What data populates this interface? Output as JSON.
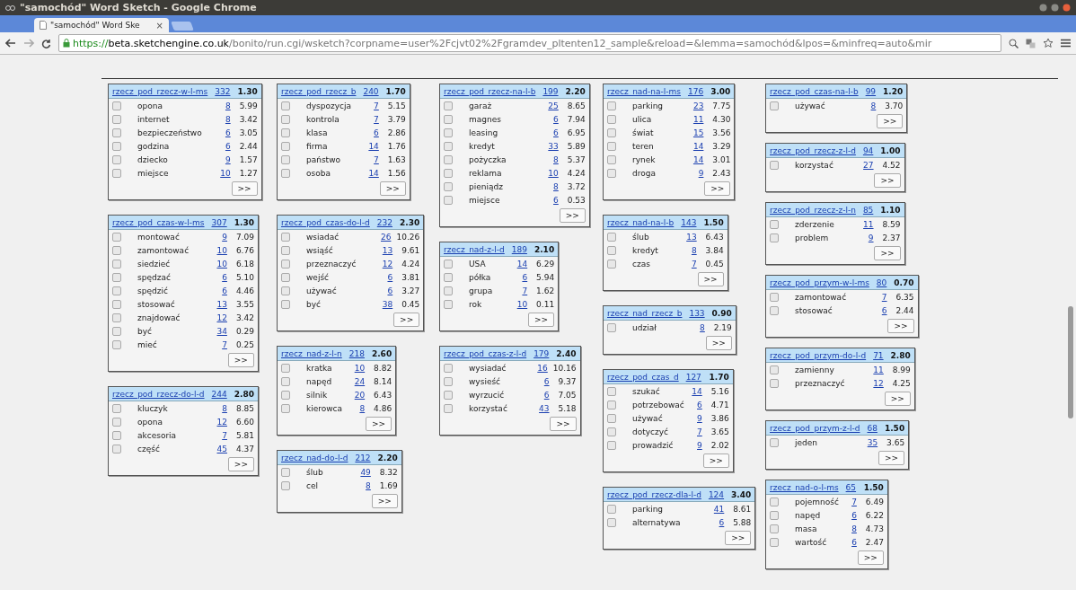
{
  "window": {
    "title": "\"samochód\" Word Sketch - Google Chrome"
  },
  "tab": {
    "label": "\"samochód\" Word Ske",
    "close": "×"
  },
  "address_bar": {
    "scheme": "https://",
    "host": "beta.sketchengine.co.uk",
    "path": "/bonito/run.cgi/wsketch?corpname=user%2Fcjvt02%2Fgramdev_pltenten12_sample&reload=&lemma=samochód&lpos=&minfreq=auto&mir"
  },
  "columns": [
    {
      "boxes": [
        {
          "relation": "rzecz_pod_rzecz-w-l-ms",
          "count": "332",
          "score": "1.30",
          "more": ">>",
          "rows": [
            {
              "word": "opona",
              "freq": "8",
              "score": "5.99",
              "checked": false
            },
            {
              "word": "internet",
              "freq": "8",
              "score": "3.42",
              "checked": false
            },
            {
              "word": "bezpieczeństwo",
              "freq": "6",
              "score": "3.05",
              "checked": false
            },
            {
              "word": "godzina",
              "freq": "6",
              "score": "2.44",
              "checked": false
            },
            {
              "word": "dziecko",
              "freq": "9",
              "score": "1.57",
              "checked": false
            },
            {
              "word": "miejsce",
              "freq": "10",
              "score": "1.27",
              "checked": false
            }
          ]
        },
        {
          "relation": "rzecz_pod_czas-w-l-ms",
          "count": "307",
          "score": "1.30",
          "more": ">>",
          "rows": [
            {
              "word": "montować",
              "freq": "9",
              "score": "7.09",
              "checked": false
            },
            {
              "word": "zamontować",
              "freq": "10",
              "score": "6.76",
              "checked": false
            },
            {
              "word": "siedzieć",
              "freq": "10",
              "score": "6.18",
              "checked": false
            },
            {
              "word": "spędzać",
              "freq": "6",
              "score": "5.10",
              "checked": false
            },
            {
              "word": "spędzić",
              "freq": "6",
              "score": "4.46",
              "checked": false
            },
            {
              "word": "stosować",
              "freq": "13",
              "score": "3.55",
              "checked": false
            },
            {
              "word": "znajdować",
              "freq": "12",
              "score": "3.42",
              "checked": false
            },
            {
              "word": "być",
              "freq": "34",
              "score": "0.29",
              "checked": false
            },
            {
              "word": "mieć",
              "freq": "7",
              "score": "0.25",
              "checked": false
            }
          ]
        },
        {
          "relation": "rzecz_pod_rzecz-do-l-d",
          "count": "244",
          "score": "2.80",
          "more": ">>",
          "rows": [
            {
              "word": "kluczyk",
              "freq": "8",
              "score": "8.85",
              "checked": false
            },
            {
              "word": "opona",
              "freq": "12",
              "score": "6.60",
              "checked": false
            },
            {
              "word": "akcesoria",
              "freq": "7",
              "score": "5.81",
              "checked": false
            },
            {
              "word": "część",
              "freq": "45",
              "score": "4.37",
              "checked": false
            }
          ]
        }
      ]
    },
    {
      "boxes": [
        {
          "relation": "rzecz_pod_rzecz_b",
          "count": "240",
          "score": "1.70",
          "more": ">>",
          "rows": [
            {
              "word": "dyspozycja",
              "freq": "7",
              "score": "5.15",
              "checked": false
            },
            {
              "word": "kontrola",
              "freq": "7",
              "score": "3.79",
              "checked": false
            },
            {
              "word": "klasa",
              "freq": "6",
              "score": "2.86",
              "checked": false
            },
            {
              "word": "firma",
              "freq": "14",
              "score": "1.76",
              "checked": false
            },
            {
              "word": "państwo",
              "freq": "7",
              "score": "1.63",
              "checked": false
            },
            {
              "word": "osoba",
              "freq": "14",
              "score": "1.56",
              "checked": false
            }
          ]
        },
        {
          "relation": "rzecz_pod_czas-do-l-d",
          "count": "232",
          "score": "2.30",
          "more": ">>",
          "rows": [
            {
              "word": "wsiadać",
              "freq": "26",
              "score": "10.26",
              "checked": false
            },
            {
              "word": "wsiąść",
              "freq": "13",
              "score": "9.61",
              "checked": false
            },
            {
              "word": "przeznaczyć",
              "freq": "12",
              "score": "4.24",
              "checked": false
            },
            {
              "word": "wejść",
              "freq": "6",
              "score": "3.81",
              "checked": false
            },
            {
              "word": "używać",
              "freq": "6",
              "score": "3.27",
              "checked": false
            },
            {
              "word": "być",
              "freq": "38",
              "score": "0.45",
              "checked": false
            }
          ]
        },
        {
          "relation": "rzecz_nad-z-l-n",
          "count": "218",
          "score": "2.60",
          "more": ">>",
          "rows": [
            {
              "word": "kratka",
              "freq": "10",
              "score": "8.82",
              "checked": false
            },
            {
              "word": "napęd",
              "freq": "24",
              "score": "8.14",
              "checked": false
            },
            {
              "word": "silnik",
              "freq": "20",
              "score": "6.43",
              "checked": false
            },
            {
              "word": "kierowca",
              "freq": "8",
              "score": "4.86",
              "checked": false
            }
          ]
        },
        {
          "relation": "rzecz_nad-do-l-d",
          "count": "212",
          "score": "2.20",
          "more": ">>",
          "rows": [
            {
              "word": "ślub",
              "freq": "49",
              "score": "8.32",
              "checked": false
            },
            {
              "word": "cel",
              "freq": "8",
              "score": "1.69",
              "checked": false
            }
          ]
        }
      ]
    },
    {
      "boxes": [
        {
          "relation": "rzecz_pod_rzecz-na-l-b",
          "count": "199",
          "score": "2.20",
          "more": ">>",
          "rows": [
            {
              "word": "garaż",
              "freq": "25",
              "score": "8.65",
              "checked": false
            },
            {
              "word": "magnes",
              "freq": "6",
              "score": "7.94",
              "checked": false
            },
            {
              "word": "leasing",
              "freq": "6",
              "score": "6.95",
              "checked": false
            },
            {
              "word": "kredyt",
              "freq": "33",
              "score": "5.89",
              "checked": false
            },
            {
              "word": "pożyczka",
              "freq": "8",
              "score": "5.37",
              "checked": false
            },
            {
              "word": "reklama",
              "freq": "10",
              "score": "4.24",
              "checked": false
            },
            {
              "word": "pieniądz",
              "freq": "8",
              "score": "3.72",
              "checked": false
            },
            {
              "word": "miejsce",
              "freq": "6",
              "score": "0.53",
              "checked": false
            }
          ]
        },
        {
          "relation": "rzecz_nad-z-l-d",
          "count": "189",
          "score": "2.10",
          "more": ">>",
          "rows": [
            {
              "word": "USA",
              "freq": "14",
              "score": "6.29",
              "checked": false
            },
            {
              "word": "półka",
              "freq": "6",
              "score": "5.94",
              "checked": false
            },
            {
              "word": "grupa",
              "freq": "7",
              "score": "1.62",
              "checked": false
            },
            {
              "word": "rok",
              "freq": "10",
              "score": "0.11",
              "checked": false
            }
          ]
        },
        {
          "relation": "rzecz_pod_czas-z-l-d",
          "count": "179",
          "score": "2.40",
          "more": ">>",
          "rows": [
            {
              "word": "wysiadać",
              "freq": "16",
              "score": "10.16",
              "checked": false
            },
            {
              "word": "wysieść",
              "freq": "6",
              "score": "9.37",
              "checked": false
            },
            {
              "word": "wyrzucić",
              "freq": "6",
              "score": "7.05",
              "checked": false
            },
            {
              "word": "korzystać",
              "freq": "43",
              "score": "5.18",
              "checked": false
            }
          ]
        }
      ]
    },
    {
      "boxes": [
        {
          "relation": "rzecz_nad-na-l-ms",
          "count": "176",
          "score": "3.00",
          "more": ">>",
          "rows": [
            {
              "word": "parking",
              "freq": "23",
              "score": "7.75",
              "checked": false
            },
            {
              "word": "ulica",
              "freq": "11",
              "score": "4.30",
              "checked": false
            },
            {
              "word": "świat",
              "freq": "15",
              "score": "3.56",
              "checked": false
            },
            {
              "word": "teren",
              "freq": "14",
              "score": "3.29",
              "checked": false
            },
            {
              "word": "rynek",
              "freq": "14",
              "score": "3.01",
              "checked": false
            },
            {
              "word": "droga",
              "freq": "9",
              "score": "2.43",
              "checked": false
            }
          ]
        },
        {
          "relation": "rzecz_nad-na-l-b",
          "count": "143",
          "score": "1.50",
          "more": ">>",
          "rows": [
            {
              "word": "ślub",
              "freq": "13",
              "score": "6.43",
              "checked": false
            },
            {
              "word": "kredyt",
              "freq": "8",
              "score": "3.84",
              "checked": false
            },
            {
              "word": "czas",
              "freq": "7",
              "score": "0.45",
              "checked": false
            }
          ]
        },
        {
          "relation": "rzecz_nad_rzecz_b",
          "count": "133",
          "score": "0.90",
          "more": ">>",
          "rows": [
            {
              "word": "udział",
              "freq": "8",
              "score": "2.19",
              "checked": false
            }
          ]
        },
        {
          "relation": "rzecz_pod_czas_d",
          "count": "127",
          "score": "1.70",
          "more": ">>",
          "rows": [
            {
              "word": "szukać",
              "freq": "14",
              "score": "5.16",
              "checked": false
            },
            {
              "word": "potrzebować",
              "freq": "6",
              "score": "4.71",
              "checked": false
            },
            {
              "word": "używać",
              "freq": "9",
              "score": "3.86",
              "checked": false
            },
            {
              "word": "dotyczyć",
              "freq": "7",
              "score": "3.65",
              "checked": false
            },
            {
              "word": "prowadzić",
              "freq": "9",
              "score": "2.02",
              "checked": false
            }
          ]
        },
        {
          "relation": "rzecz_pod_rzecz-dla-l-d",
          "count": "124",
          "score": "3.40",
          "more": ">>",
          "rows": [
            {
              "word": "parking",
              "freq": "41",
              "score": "8.61",
              "checked": false
            },
            {
              "word": "alternatywa",
              "freq": "6",
              "score": "5.88",
              "checked": false
            }
          ]
        }
      ]
    },
    {
      "boxes": [
        {
          "relation": "rzecz_pod_czas-na-l-b",
          "count": "99",
          "score": "1.20",
          "more": ">>",
          "rows": [
            {
              "word": "używać",
              "freq": "8",
              "score": "3.70",
              "checked": false
            }
          ]
        },
        {
          "relation": "rzecz_pod_rzecz-z-l-d",
          "count": "94",
          "score": "1.00",
          "more": ">>",
          "rows": [
            {
              "word": "korzystać",
              "freq": "27",
              "score": "4.52",
              "checked": false
            }
          ]
        },
        {
          "relation": "rzecz_pod_rzecz-z-l-n",
          "count": "85",
          "score": "1.10",
          "more": ">>",
          "rows": [
            {
              "word": "zderzenie",
              "freq": "11",
              "score": "8.59",
              "checked": false
            },
            {
              "word": "problem",
              "freq": "9",
              "score": "2.37",
              "checked": false
            }
          ]
        },
        {
          "relation": "rzecz_pod_przym-w-l-ms",
          "count": "80",
          "score": "0.70",
          "more": ">>",
          "rows": [
            {
              "word": "zamontować",
              "freq": "7",
              "score": "6.35",
              "checked": false
            },
            {
              "word": "stosować",
              "freq": "6",
              "score": "2.44",
              "checked": false
            }
          ]
        },
        {
          "relation": "rzecz_pod_przym-do-l-d",
          "count": "71",
          "score": "2.80",
          "more": ">>",
          "rows": [
            {
              "word": "zamienny",
              "freq": "11",
              "score": "8.99",
              "checked": false
            },
            {
              "word": "przeznaczyć",
              "freq": "12",
              "score": "4.25",
              "checked": false
            }
          ]
        },
        {
          "relation": "rzecz_pod_przym-z-l-d",
          "count": "68",
          "score": "1.50",
          "more": ">>",
          "rows": [
            {
              "word": "jeden",
              "freq": "35",
              "score": "3.65",
              "checked": false
            }
          ]
        },
        {
          "relation": "rzecz_nad-o-l-ms",
          "count": "65",
          "score": "1.50",
          "more": ">>",
          "rows": [
            {
              "word": "pojemność",
              "freq": "7",
              "score": "6.49",
              "checked": false
            },
            {
              "word": "napęd",
              "freq": "6",
              "score": "6.22",
              "checked": false
            },
            {
              "word": "masa",
              "freq": "8",
              "score": "4.73",
              "checked": false
            },
            {
              "word": "wartość",
              "freq": "6",
              "score": "2.47",
              "checked": false
            }
          ]
        }
      ]
    }
  ]
}
